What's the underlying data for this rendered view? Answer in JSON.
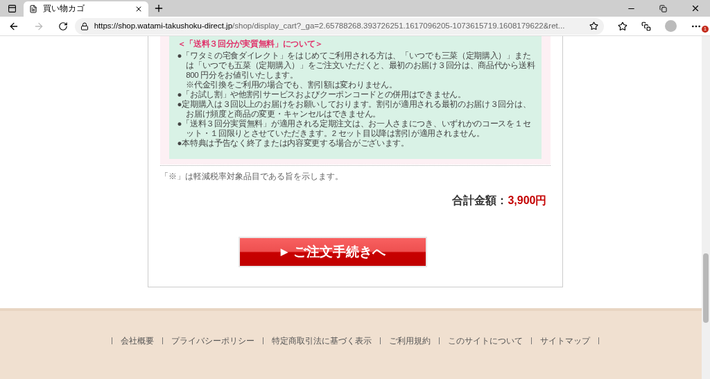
{
  "browser": {
    "tab_title": "買い物カゴ",
    "url_host": "https://shop.watami-takushoku-direct.jp",
    "url_path": "/shop/display_cart?_ga=2.65788268.393726251.1617096205-1073615719.1608179622&ret...",
    "notification_count": "1"
  },
  "notice": {
    "heading": "＜「送料３回分が実質無料」について＞",
    "items": [
      {
        "kind": "bullet",
        "text": "●「ワタミの宅食ダイレクト」をはじめてご利用される方は、「いつでも三菜（定期購入）」または「いつでも五菜（定期購入）」をご注文いただくと、最初のお届け３回分は、商品代から送料 800 円分をお値引いたします。"
      },
      {
        "kind": "note",
        "text": "※代金引換をご利用の場合でも、割引額は変わりません。"
      },
      {
        "kind": "bullet",
        "text": "●「お試し割」や他割引サービスおよびクーポンコードとの併用はできません。"
      },
      {
        "kind": "bullet",
        "text": "●定期購入は３回以上のお届けをお願いしております。割引が適用される最初のお届け３回分は、お届け頻度と商品の変更・キャンセルはできません。"
      },
      {
        "kind": "bullet",
        "text": "●「送料３回分実質無料」が適用される定期注文は、お一人さまにつき、いずれかのコースを１セット・１回限りとさせていただきます。2 セット目以降は割引が適用されません。"
      },
      {
        "kind": "bullet",
        "text": "●本特典は予告なく終了または内容変更する場合がございます。"
      }
    ]
  },
  "tax_note": "「※」は軽減税率対象品目である旨を示します。",
  "total": {
    "label": "合計金額：",
    "amount": "3,900円"
  },
  "order_button": {
    "arrow": "▶",
    "label": "ご注文手続きへ"
  },
  "footer_links": [
    "会社概要",
    "プライバシーポリシー",
    "特定商取引法に基づく表示",
    "ご利用規約",
    "このサイトについて",
    "サイトマップ"
  ]
}
